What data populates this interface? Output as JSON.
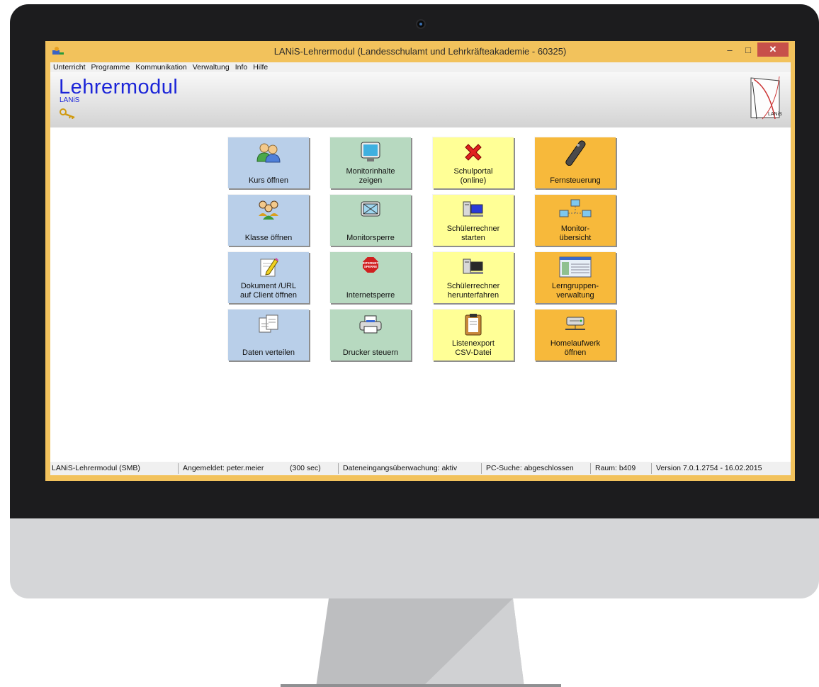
{
  "window": {
    "title": "LANiS-Lehrermodul  (Landesschulamt und Lehrkräfteakademie - 60325)"
  },
  "menu": [
    "Unterricht",
    "Programme",
    "Kommunikation",
    "Verwaltung",
    "Info",
    "Hilfe"
  ],
  "banner": {
    "title": "Lehrermodul",
    "subtitle": "LANiS",
    "logo_text": "LANiS"
  },
  "tiles": [
    {
      "label": "Kurs öffnen",
      "icon": "users-icon",
      "color": "#b9cfe9"
    },
    {
      "label": "Monitorinhalte\nzeigen",
      "icon": "monitor-icon",
      "color": "#b7d9c0"
    },
    {
      "label": "Schulportal\n(online)",
      "icon": "red-x-icon",
      "color": "#ffff96"
    },
    {
      "label": "Fernsteuerung",
      "icon": "remote-control-icon",
      "color": "#f7b93b"
    },
    {
      "label": "Klasse öffnen",
      "icon": "class-group-icon",
      "color": "#b9cfe9"
    },
    {
      "label": "Monitorsperre",
      "icon": "monitor-lock-icon",
      "color": "#b7d9c0"
    },
    {
      "label": "Schülerrechner\nstarten",
      "icon": "computer-start-icon",
      "color": "#ffff96"
    },
    {
      "label": "Monitor-\nübersicht",
      "icon": "network-monitors-icon",
      "color": "#f7b93b"
    },
    {
      "label": "Dokument /URL\nauf Client öffnen",
      "icon": "document-edit-icon",
      "color": "#b9cfe9"
    },
    {
      "label": "Internetsperre",
      "icon": "internet-stop-icon",
      "color": "#b7d9c0",
      "icon_text": "INTERNET\nSPERRE"
    },
    {
      "label": "Schülerrechner\nherunterfahren",
      "icon": "computer-shutdown-icon",
      "color": "#ffff96"
    },
    {
      "label": "Lerngruppen-\nverwaltung",
      "icon": "spreadsheet-icon",
      "color": "#f7b93b"
    },
    {
      "label": "Daten verteilen",
      "icon": "documents-icon",
      "color": "#b9cfe9"
    },
    {
      "label": "Drucker steuern",
      "icon": "printer-icon",
      "color": "#b7d9c0"
    },
    {
      "label": "Listenexport\nCSV-Datei",
      "icon": "clipboard-icon",
      "color": "#ffff96"
    },
    {
      "label": "Homelaufwerk\nöffnen",
      "icon": "network-drive-icon",
      "color": "#f7b93b"
    }
  ],
  "statusbar": [
    "LANiS-Lehrermodul (SMB)",
    "Angemeldet: peter.meier",
    "(300 sec)",
    "Dateneingangsüberwachung: aktiv",
    "PC-Suche: abgeschlossen",
    "Raum: b409",
    "Version 7.0.1.2754 - 16.02.2015"
  ]
}
